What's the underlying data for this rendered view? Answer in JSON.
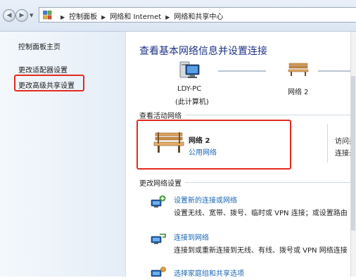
{
  "address_bar": {
    "crumbs": [
      "控制面板",
      "网络和 Internet",
      "网络和共享中心"
    ]
  },
  "sidebar": {
    "items": [
      {
        "label": "控制面板主页"
      },
      {
        "label": "更改适配器设置"
      },
      {
        "label": "更改高级共享设置"
      }
    ]
  },
  "main": {
    "title": "查看基本网络信息并设置连接",
    "map": {
      "computer_name": "LDY-PC",
      "computer_sub": "(此计算机)",
      "network_name": "网络  2"
    },
    "active_networks": {
      "heading": "查看活动网络",
      "network_name": "网络  2",
      "network_type": "公用网络",
      "access_type_label": "访问类",
      "connections_label": "连接:"
    },
    "change_settings": {
      "heading": "更改网络设置",
      "tasks": [
        {
          "title": "设置新的连接或网络",
          "desc": "设置无线、宽带、拨号、临时或 VPN 连接；或设置路由"
        },
        {
          "title": "连接到网络",
          "desc": "连接到或重新连接到无线、有线、拨号或 VPN 网络连接"
        },
        {
          "title": "选择家庭组和共享选项",
          "desc": ""
        }
      ]
    }
  },
  "colors": {
    "title_blue": "#1e3287",
    "link_blue": "#1a66b3",
    "highlight_red": "#e42a20"
  }
}
